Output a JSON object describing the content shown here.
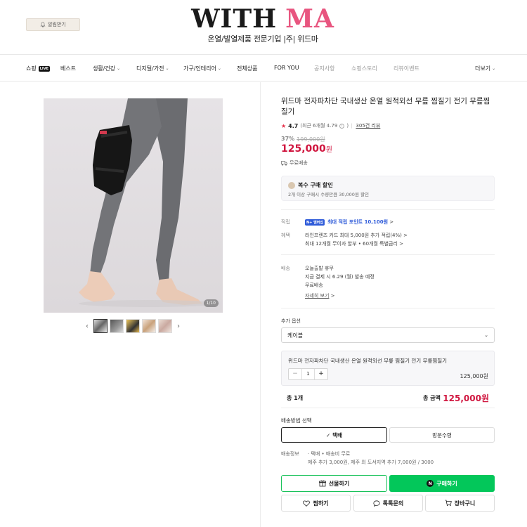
{
  "header": {
    "alarm_label": "알림받기",
    "logo_left": "WITH",
    "logo_right": "MA",
    "logo_sub": "온열/발열제품 전문기업 |주| 위드마"
  },
  "nav": {
    "items": [
      {
        "label": "쇼핑",
        "badge": "LIVE"
      },
      {
        "label": "베스트"
      },
      {
        "label": "생활/건강",
        "chevron": "⌄"
      },
      {
        "label": "디지털/가전",
        "chevron": "⌄"
      },
      {
        "label": "가구/인테리어",
        "chevron": "⌄"
      },
      {
        "label": "전체상품"
      },
      {
        "label": "FOR YOU"
      },
      {
        "label": "공지사항"
      },
      {
        "label": "쇼핑스토리"
      },
      {
        "label": "리뷰이벤트"
      },
      {
        "label": "더보기",
        "chevron": "⌄"
      }
    ]
  },
  "gallery": {
    "counter": "1/10"
  },
  "product": {
    "title": "위드마 전자파차단 국내생산 온열 원적외선 무릎 찜질기 전기 무릎찜질기",
    "rating": "4.7",
    "rating_recent": "(최근 6개월 4.79",
    "rating_close": ")",
    "reviews": "305건 리뷰",
    "discount": "37%",
    "original_price": "199,000원",
    "price": "125,000",
    "price_unit": "원",
    "free_shipping": "무료배송"
  },
  "multi_buy": {
    "title": "복수 구매 할인",
    "desc": "2개 이상 구매시 수량만큼 30,000원 할인"
  },
  "benefits": {
    "points_label": "적립",
    "npay_badge": "N+",
    "npay_badge2": "멤버십",
    "points_text": "최대 적립 포인트 10,100원",
    "points_chevron": ">",
    "benefit_label": "혜택",
    "benefit_line1": "라인프렌즈 카드 최대 5,000원 추가 적립(4%)",
    "benefit_chevron": ">",
    "benefit_line2": "최대 12개월 무이자 할부 • 60개월 특별금리",
    "benefit_chevron2": ">"
  },
  "delivery": {
    "label": "배송",
    "line1": "오늘출발 휴무",
    "line2": "지금 결제 시 6.29 (월) 발송 예정",
    "line3": "무료배송",
    "detail_link": "자세히 보기",
    "detail_chevron": ">"
  },
  "options": {
    "label": "추가 옵션",
    "selected": "케이블",
    "chevron": "⌄"
  },
  "selection": {
    "name": "위드마 전자파차단 국내생산 온열 원적외선 무릎 찜질기 전기 무릎찜질기",
    "minus": "−",
    "qty": "1",
    "plus": "+",
    "price": "125,000원"
  },
  "total": {
    "count_label": "총 1개",
    "sum_label": "총 금액",
    "sum_value": "125,000원"
  },
  "shipping_method": {
    "label": "배송방법 선택",
    "option1": "택배",
    "option2": "방문수령",
    "check": "✓"
  },
  "shipping_info": {
    "label": "배송정보",
    "line1": "· 택배 • 배송비 무료",
    "line2": "제주 추가 3,000원, 제주 외 도서지역 추가 7,000원 / 3000"
  },
  "actions": {
    "gift": "선물하기",
    "buy": "구매하기",
    "buy_icon": "N",
    "wish": "찜하기",
    "talk": "톡톡문의",
    "cart": "장바구니"
  },
  "colors": {
    "accent_red": "#d0163f",
    "naver_green": "#03c75a",
    "logo_pink": "#e8557f"
  }
}
